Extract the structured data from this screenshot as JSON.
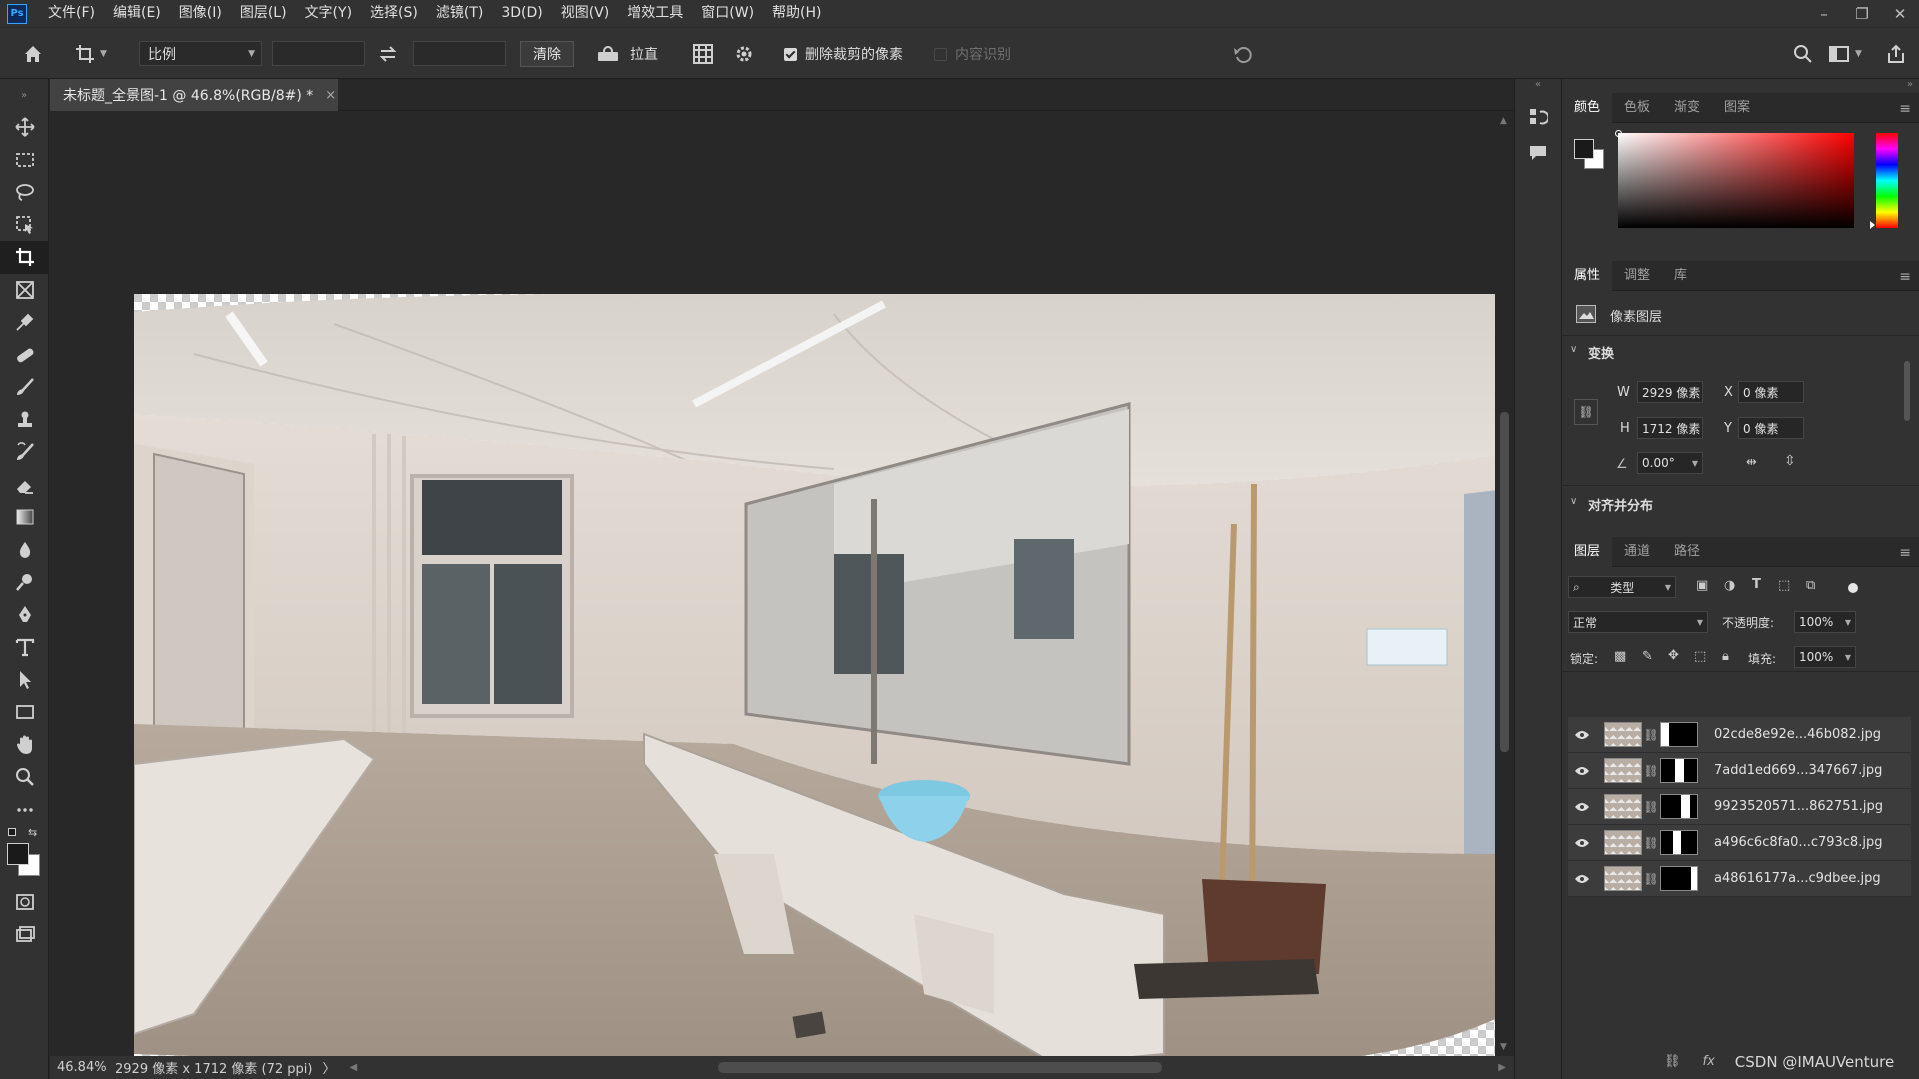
{
  "app": {
    "logo": "Ps"
  },
  "menu": [
    "文件(F)",
    "编辑(E)",
    "图像(I)",
    "图层(L)",
    "文字(Y)",
    "选择(S)",
    "滤镜(T)",
    "3D(D)",
    "视图(V)",
    "增效工具",
    "窗口(W)",
    "帮助(H)"
  ],
  "window_controls": {
    "minimize": "–",
    "restore": "❐",
    "close": "✕"
  },
  "options": {
    "ratio_select": "比例",
    "clear_label": "清除",
    "straighten_label": "拉直",
    "delete_cropped_label": "删除裁剪的像素",
    "delete_cropped_checked": true,
    "content_aware_label": "内容识别",
    "content_aware_checked": false
  },
  "document": {
    "tab_title": "未标题_全景图-1 @ 46.8%(RGB/8#) *",
    "tab_close": "×"
  },
  "status": {
    "zoom": "46.84%",
    "info": "2929 像素 x 1712 像素 (72 ppi)",
    "arrow": "〉"
  },
  "color_panel": {
    "tabs": [
      "颜色",
      "色板",
      "渐变",
      "图案"
    ],
    "foreground": "#1a1a1a",
    "background": "#ffffff",
    "hue": "#ff0000"
  },
  "properties_panel": {
    "tabs": [
      "属性",
      "调整",
      "库"
    ],
    "kind": "像素图层",
    "transform_header": "变换",
    "w_label": "W",
    "w_value": "2929 像素",
    "x_label": "X",
    "x_value": "0 像素",
    "h_label": "H",
    "h_value": "1712 像素",
    "y_label": "Y",
    "y_value": "0 像素",
    "angle_value": "0.00°",
    "align_header": "对齐并分布"
  },
  "layers_panel": {
    "tabs": [
      "图层",
      "通道",
      "路径"
    ],
    "filter_label": "类型",
    "blend_mode": "正常",
    "opacity_label": "不透明度:",
    "opacity_value": "100%",
    "lock_label": "锁定:",
    "fill_label": "填充:",
    "fill_value": "100%",
    "layers": [
      {
        "name": "02cde8e92e...46b082.jpg"
      },
      {
        "name": "7add1ed669...347667.jpg"
      },
      {
        "name": "9923520571...862751.jpg"
      },
      {
        "name": "a496c6c8fa0...c793c8.jpg"
      },
      {
        "name": "a48616177a...c9dbee.jpg"
      }
    ],
    "footer_fx": "fx",
    "watermark": "CSDN @IMAUVenture"
  }
}
